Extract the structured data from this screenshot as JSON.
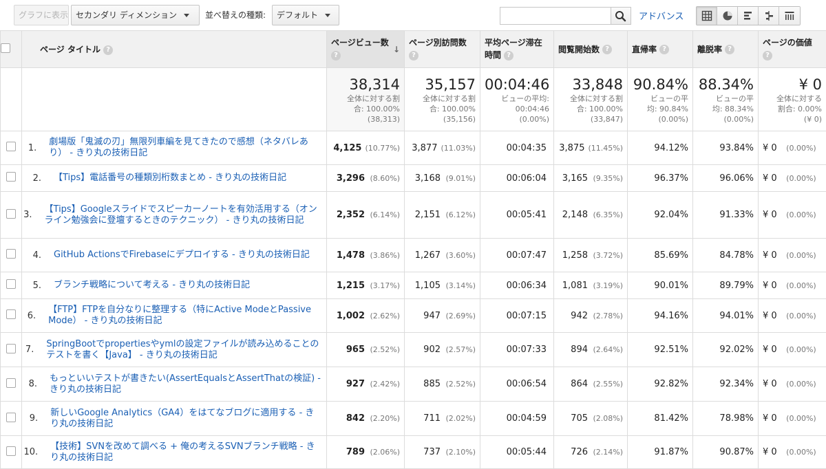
{
  "toolbar": {
    "chart_button": "グラフに表示",
    "secondary_dimension": "セカンダリ ディメンション",
    "sort_type_label": "並べ替えの種類:",
    "sort_type_value": "デフォルト",
    "search_placeholder": "",
    "advanced_link": "アドバンス",
    "views": [
      "table-view-icon",
      "pie-view-icon",
      "performance-view-icon",
      "comparison-view-icon",
      "pivot-view-icon"
    ]
  },
  "columns": [
    {
      "key": "title",
      "label": "ページ タイトル"
    },
    {
      "key": "pageviews",
      "label": "ページビュー数"
    },
    {
      "key": "unique",
      "label": "ページ別訪問数"
    },
    {
      "key": "avg_time",
      "label": "平均ページ滞在時間"
    },
    {
      "key": "entrances",
      "label": "閲覧開始数"
    },
    {
      "key": "bounce",
      "label": "直帰率"
    },
    {
      "key": "exit",
      "label": "離脱率"
    },
    {
      "key": "value",
      "label": "ページの価値"
    }
  ],
  "totals": {
    "pageviews": {
      "big": "38,314",
      "sub1": "全体に対する割",
      "sub2": "合: 100.00%",
      "sub3": "(38,313)"
    },
    "unique": {
      "big": "35,157",
      "sub1": "全体に対する割",
      "sub2": "合: 100.00%",
      "sub3": "(35,156)"
    },
    "avg_time": {
      "big": "00:04:46",
      "sub1": "ビューの平均:",
      "sub2": "00:04:46",
      "sub3": "(0.00%)"
    },
    "entrances": {
      "big": "33,848",
      "sub1": "全体に対する割",
      "sub2": "合: 100.00%",
      "sub3": "(33,847)"
    },
    "bounce": {
      "big": "90.84%",
      "sub1": "ビューの平",
      "sub2": "均: 90.84%",
      "sub3": "(0.00%)"
    },
    "exit": {
      "big": "88.34%",
      "sub1": "ビューの平",
      "sub2": "均: 88.34%",
      "sub3": "(0.00%)"
    },
    "value": {
      "big": "¥ 0",
      "sub1": "全体に対する",
      "sub2": "割合: 0.00%",
      "sub3": "(¥ 0)"
    }
  },
  "rows": [
    {
      "idx": "1.",
      "title": "劇場版「鬼滅の刃」無限列車編を見てきたので感想（ネタバレあり） - きり丸の技術日記",
      "pv": "4,125",
      "pv_p": "(10.77%)",
      "uv": "3,877",
      "uv_p": "(11.03%)",
      "time": "00:04:35",
      "ent": "3,875",
      "ent_p": "(11.45%)",
      "bounce": "94.12%",
      "exit": "93.84%",
      "val": "¥ 0",
      "val_p": "(0.00%)"
    },
    {
      "idx": "2.",
      "title": "【Tips】電話番号の種類別桁数まとめ - きり丸の技術日記",
      "pv": "3,296",
      "pv_p": "(8.60%)",
      "uv": "3,168",
      "uv_p": "(9.01%)",
      "time": "00:06:04",
      "ent": "3,165",
      "ent_p": "(9.35%)",
      "bounce": "96.37%",
      "exit": "96.06%",
      "val": "¥ 0",
      "val_p": "(0.00%)"
    },
    {
      "idx": "3.",
      "title": "【Tips】Googleスライドでスピーカーノートを有効活用する（オンライン勉強会に登壇するときのテクニック） - きり丸の技術日記",
      "pv": "2,352",
      "pv_p": "(6.14%)",
      "uv": "2,151",
      "uv_p": "(6.12%)",
      "time": "00:05:41",
      "ent": "2,148",
      "ent_p": "(6.35%)",
      "bounce": "92.04%",
      "exit": "91.33%",
      "val": "¥ 0",
      "val_p": "(0.00%)"
    },
    {
      "idx": "4.",
      "title": "GitHub ActionsでFirebaseにデプロイする - きり丸の技術日記",
      "pv": "1,478",
      "pv_p": "(3.86%)",
      "uv": "1,267",
      "uv_p": "(3.60%)",
      "time": "00:07:47",
      "ent": "1,258",
      "ent_p": "(3.72%)",
      "bounce": "85.69%",
      "exit": "84.78%",
      "val": "¥ 0",
      "val_p": "(0.00%)"
    },
    {
      "idx": "5.",
      "title": "ブランチ戦略について考える - きり丸の技術日記",
      "pv": "1,215",
      "pv_p": "(3.17%)",
      "uv": "1,105",
      "uv_p": "(3.14%)",
      "time": "00:06:34",
      "ent": "1,081",
      "ent_p": "(3.19%)",
      "bounce": "90.01%",
      "exit": "89.79%",
      "val": "¥ 0",
      "val_p": "(0.00%)"
    },
    {
      "idx": "6.",
      "title": "【FTP】FTPを自分なりに整理する（特にActive ModeとPassive Mode） - きり丸の技術日記",
      "pv": "1,002",
      "pv_p": "(2.62%)",
      "uv": "947",
      "uv_p": "(2.69%)",
      "time": "00:07:15",
      "ent": "942",
      "ent_p": "(2.78%)",
      "bounce": "94.16%",
      "exit": "94.01%",
      "val": "¥ 0",
      "val_p": "(0.00%)"
    },
    {
      "idx": "7.",
      "title": "SpringBootでpropertiesやymlの設定ファイルが読み込めることのテストを書く【Java】 - きり丸の技術日記",
      "pv": "965",
      "pv_p": "(2.52%)",
      "uv": "902",
      "uv_p": "(2.57%)",
      "time": "00:07:33",
      "ent": "894",
      "ent_p": "(2.64%)",
      "bounce": "92.51%",
      "exit": "92.02%",
      "val": "¥ 0",
      "val_p": "(0.00%)"
    },
    {
      "idx": "8.",
      "title": "もっといいテストが書きたい(AssertEqualsとAssertThatの検証) - きり丸の技術日記",
      "pv": "927",
      "pv_p": "(2.42%)",
      "uv": "885",
      "uv_p": "(2.52%)",
      "time": "00:06:54",
      "ent": "864",
      "ent_p": "(2.55%)",
      "bounce": "92.82%",
      "exit": "92.34%",
      "val": "¥ 0",
      "val_p": "(0.00%)"
    },
    {
      "idx": "9.",
      "title": "新しいGoogle Analytics（GA4）をはてなブログに適用する - きり丸の技術日記",
      "pv": "842",
      "pv_p": "(2.20%)",
      "uv": "711",
      "uv_p": "(2.02%)",
      "time": "00:04:59",
      "ent": "705",
      "ent_p": "(2.08%)",
      "bounce": "81.42%",
      "exit": "78.98%",
      "val": "¥ 0",
      "val_p": "(0.00%)"
    },
    {
      "idx": "10.",
      "title": "【技術】SVNを改めて調べる + 俺の考えるSVNブランチ戦略 - きり丸の技術日記",
      "pv": "789",
      "pv_p": "(2.06%)",
      "uv": "737",
      "uv_p": "(2.10%)",
      "time": "00:05:44",
      "ent": "726",
      "ent_p": "(2.14%)",
      "bounce": "91.87%",
      "exit": "90.87%",
      "val": "¥ 0",
      "val_p": "(0.00%)"
    }
  ]
}
